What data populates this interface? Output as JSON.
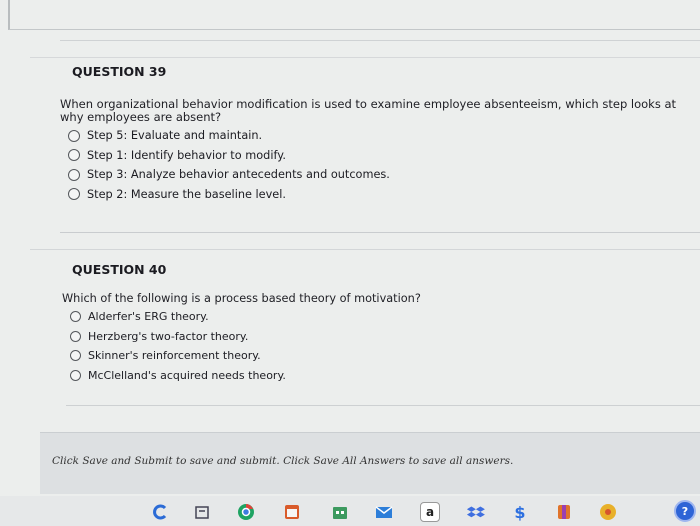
{
  "questions": [
    {
      "title": "QUESTION 39",
      "text": "When organizational behavior modification is used to examine employee absenteeism, which step looks at why employees are absent?",
      "options": [
        "Step 5: Evaluate and maintain.",
        "Step 1: Identify behavior to modify.",
        "Step 3: Analyze behavior antecedents and outcomes.",
        "Step 2: Measure the baseline level."
      ]
    },
    {
      "title": "QUESTION 40",
      "text": "Which of the following is a process based theory of motivation?",
      "options": [
        "Alderfer's ERG theory.",
        "Herzberg's two-factor theory.",
        "Skinner's reinforcement theory.",
        "McClelland's acquired needs theory."
      ]
    }
  ],
  "footer": {
    "instructions": "Click Save and Submit to save and submit. Click Save All Answers to save all answers."
  },
  "taskbar": {
    "icons": [
      "edge-icon",
      "files-icon",
      "chrome-icon",
      "calendar-icon",
      "store-icon",
      "mail-icon",
      "amazon-icon",
      "dropbox-icon",
      "dollar-icon",
      "orange-app-icon",
      "yellow-app-icon"
    ],
    "amazon_letter": "a",
    "dollar_glyph": "$",
    "help_label": "?"
  },
  "colors": {
    "help": "#2e64d6"
  }
}
